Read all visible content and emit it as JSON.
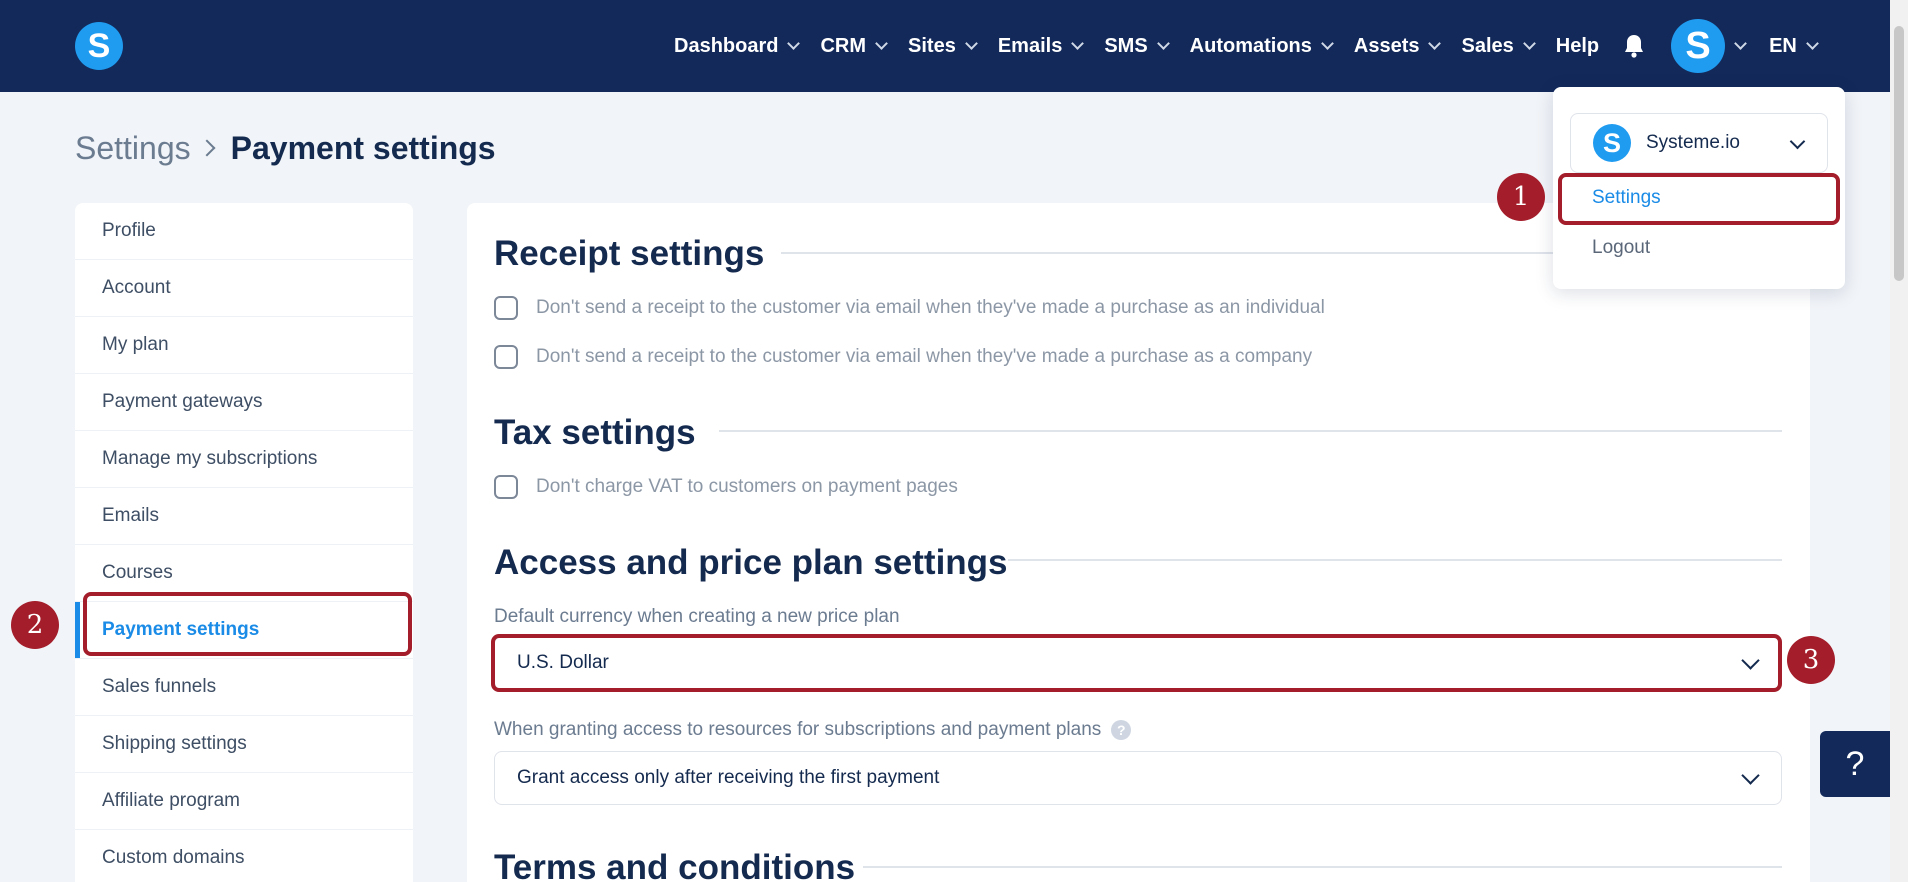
{
  "nav": {
    "items": [
      {
        "label": "Dashboard",
        "chevron": true
      },
      {
        "label": "CRM",
        "chevron": true
      },
      {
        "label": "Sites",
        "chevron": true
      },
      {
        "label": "Emails",
        "chevron": true
      },
      {
        "label": "SMS",
        "chevron": true
      },
      {
        "label": "Automations",
        "chevron": true
      },
      {
        "label": "Assets",
        "chevron": true
      },
      {
        "label": "Sales",
        "chevron": true
      },
      {
        "label": "Help",
        "chevron": false
      }
    ],
    "logo_letter": "S",
    "avatar_letter": "S",
    "language": "EN",
    "icons": {
      "notifications": "bell-icon"
    }
  },
  "breadcrumb": {
    "parent": "Settings",
    "current": "Payment settings"
  },
  "sidebar": {
    "items": [
      {
        "label": "Profile",
        "active": false
      },
      {
        "label": "Account",
        "active": false
      },
      {
        "label": "My plan",
        "active": false
      },
      {
        "label": "Payment gateways",
        "active": false
      },
      {
        "label": "Manage my subscriptions",
        "active": false
      },
      {
        "label": "Emails",
        "active": false
      },
      {
        "label": "Courses",
        "active": false
      },
      {
        "label": "Payment settings",
        "active": true
      },
      {
        "label": "Sales funnels",
        "active": false
      },
      {
        "label": "Shipping settings",
        "active": false
      },
      {
        "label": "Affiliate program",
        "active": false
      },
      {
        "label": "Custom domains",
        "active": false
      }
    ]
  },
  "main": {
    "receipt": {
      "title": "Receipt settings",
      "options": [
        "Don't send a receipt to the customer via email when they've made a purchase as an individual",
        "Don't send a receipt to the customer via email when they've made a purchase as a company"
      ]
    },
    "tax": {
      "title": "Tax settings",
      "options": [
        "Don't charge VAT to customers on payment pages"
      ]
    },
    "access": {
      "title": "Access and price plan settings",
      "currency_label": "Default currency when creating a new price plan",
      "currency_value": "U.S. Dollar",
      "grant_label": "When granting access to resources for subscriptions and payment plans",
      "grant_value": "Grant access only after receiving the first payment"
    },
    "terms": {
      "title": "Terms and conditions"
    }
  },
  "dropdown": {
    "workspace_name": "Systeme.io",
    "workspace_logo_letter": "S",
    "items": [
      "Settings",
      "Logout"
    ]
  },
  "annotations": [
    "1",
    "2",
    "3"
  ],
  "help_widget": "?",
  "colors": {
    "topbar": "#13295a",
    "accent": "#1a8be6",
    "brand": "#1f9bf0",
    "annotation": "#a31d2a"
  }
}
